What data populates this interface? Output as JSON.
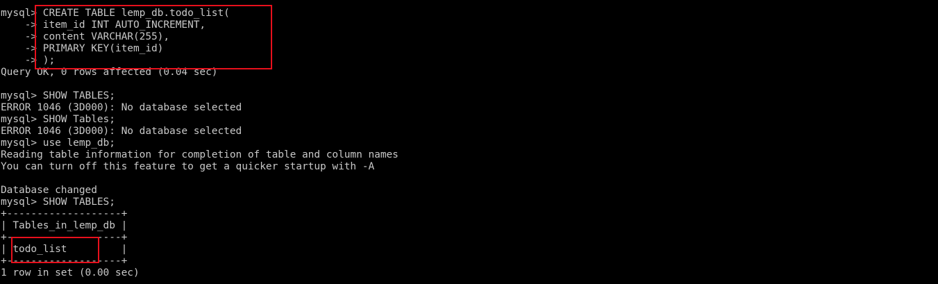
{
  "terminal": {
    "lines": [
      "mysql> CREATE TABLE lemp_db.todo_list(",
      "    -> item_id INT AUTO_INCREMENT,",
      "    -> content VARCHAR(255),",
      "    -> PRIMARY KEY(item_id)",
      "    -> );",
      "Query OK, 0 rows affected (0.04 sec)",
      "",
      "mysql> SHOW TABLES;",
      "ERROR 1046 (3D000): No database selected",
      "mysql> SHOW Tables;",
      "ERROR 1046 (3D000): No database selected",
      "mysql> use lemp_db;",
      "Reading table information for completion of table and column names",
      "You can turn off this feature to get a quicker startup with -A",
      "",
      "Database changed",
      "mysql> SHOW TABLES;",
      "+-------------------+",
      "| Tables_in_lemp_db |",
      "+-------------------+",
      "| todo_list         |",
      "+-------------------+",
      "1 row in set (0.00 sec)"
    ]
  },
  "colors": {
    "background": "#000000",
    "text": "#c8c8c8",
    "highlight": "#e8101c"
  }
}
